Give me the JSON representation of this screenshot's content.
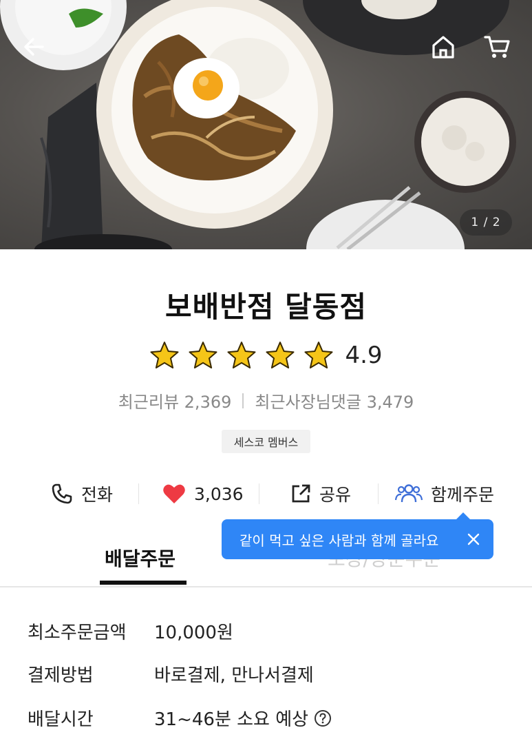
{
  "hero": {
    "page_indicator": "1 / 2"
  },
  "store": {
    "name": "보배반점 달동점",
    "rating": "4.9",
    "star_count": 5,
    "star_color": "#f5c518",
    "recent_reviews": "최근리뷰 2,369",
    "recent_owner_comments": "최근사장님댓글 3,479",
    "badge": "세스코 멤버스"
  },
  "actions": {
    "call_label": "전화",
    "like_count": "3,036",
    "share_label": "공유",
    "group_order_label": "함께주문"
  },
  "tooltip": {
    "text": "같이 먹고 싶은 사람과 함께 골라요",
    "color": "#2f86f6"
  },
  "tabs": {
    "delivery": "배달주문",
    "pickup": "포장/방문주문"
  },
  "info": {
    "min_order_label": "최소주문금액",
    "min_order_value": "10,000원",
    "payment_label": "결제방법",
    "payment_value": "바로결제, 만나서결제",
    "delivery_time_label": "배달시간",
    "delivery_time_value": "31~46분 소요 예상"
  },
  "colors": {
    "heart": "#ee3a43",
    "group_icon": "#3f6fd8"
  }
}
